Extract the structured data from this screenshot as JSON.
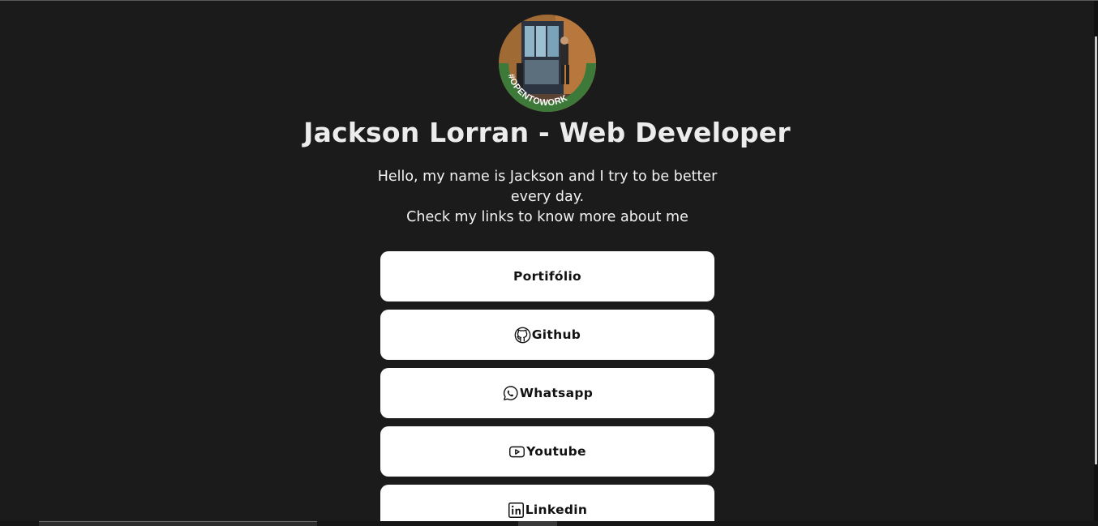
{
  "profile": {
    "name": "Jackson Lorran - Web Developer",
    "badge": "#OPENTOWORK",
    "bio_line1": "Hello, my name is Jackson and I try to be better every day.",
    "bio_line2": "Check my links to know more about me"
  },
  "links": [
    {
      "label": "Portifólio",
      "icon": null
    },
    {
      "label": "Github",
      "icon": "github-icon"
    },
    {
      "label": "Whatsapp",
      "icon": "whatsapp-icon"
    },
    {
      "label": "Youtube",
      "icon": "youtube-icon"
    },
    {
      "label": "Linkedin",
      "icon": "linkedin-icon"
    }
  ],
  "colors": {
    "background": "#1b1b1b",
    "button": "#ffffff",
    "text": "#ececec",
    "badge_green": "#3d7a3a"
  }
}
